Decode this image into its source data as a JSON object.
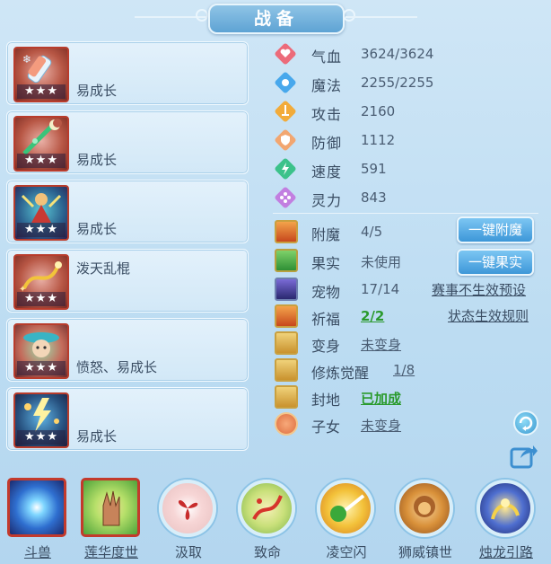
{
  "title": "战备",
  "items": [
    {
      "label": "易成长",
      "stars": "★★★",
      "icon": "ice-pole-icon"
    },
    {
      "label": "易成长",
      "stars": "★★★",
      "icon": "moon-staff-icon"
    },
    {
      "label": "易成长",
      "stars": "★★★",
      "icon": "warrior-sprite-icon"
    },
    {
      "label": "泼天乱棍",
      "stars": "★★★",
      "icon": "dragon-staff-icon"
    },
    {
      "label": "愤怒、易成长",
      "stars": "★★★",
      "icon": "blossom-mask-icon"
    },
    {
      "label": "易成长",
      "stars": "★★★",
      "icon": "lightning-sprite-icon"
    }
  ],
  "stats": [
    {
      "label": "气血",
      "value": "3624/3624",
      "icon": "heart-icon",
      "color": "#e85a6a"
    },
    {
      "label": "魔法",
      "value": "2255/2255",
      "icon": "mana-crystal-icon",
      "color": "#3fa0e8"
    },
    {
      "label": "攻击",
      "value": "2160",
      "icon": "sword-icon",
      "color": "#f0a531"
    },
    {
      "label": "防御",
      "value": "1112",
      "icon": "shield-icon",
      "color": "#f2a06a"
    },
    {
      "label": "速度",
      "value": "591",
      "icon": "lightning-icon",
      "color": "#3cc28a"
    },
    {
      "label": "灵力",
      "value": "843",
      "icon": "spirit-icon",
      "color": "#c07ade"
    }
  ],
  "extras": [
    {
      "label": "附魔",
      "value": "4/5",
      "icon": "enchant-icon"
    },
    {
      "label": "果实",
      "value": "未使用",
      "icon": "fruit-icon"
    },
    {
      "label": "宠物",
      "value": "17/14",
      "icon": "pet-icon"
    },
    {
      "label": "祈福",
      "value": "2/2",
      "icon": "blessing-icon"
    },
    {
      "label": "变身",
      "value": "未变身",
      "icon": "transform-icon"
    },
    {
      "label": "修炼觉醒",
      "value": "1/8",
      "icon": "cultivation-icon"
    },
    {
      "label": "封地",
      "value": "已加成",
      "icon": "fief-icon"
    },
    {
      "label": "子女",
      "value": "未变身",
      "icon": "children-icon"
    }
  ],
  "buttons": {
    "enchant": "一键附魔",
    "fruit": "一键果实"
  },
  "links": {
    "tournament": "赛事不生效预设",
    "status_rules": "状态生效规则"
  },
  "skills": [
    {
      "label": "斗兽",
      "icon": "beast-orb-icon"
    },
    {
      "label": "莲华度世",
      "icon": "lotus-hand-icon"
    },
    {
      "label": "汲取",
      "icon": "absorb-swirl-icon"
    },
    {
      "label": "致命",
      "icon": "fatal-strike-icon"
    },
    {
      "label": "凌空闪",
      "icon": "sky-flash-icon"
    },
    {
      "label": "狮威镇世",
      "icon": "lion-might-icon"
    },
    {
      "label": "烛龙引路",
      "icon": "candle-dragon-icon"
    }
  ]
}
